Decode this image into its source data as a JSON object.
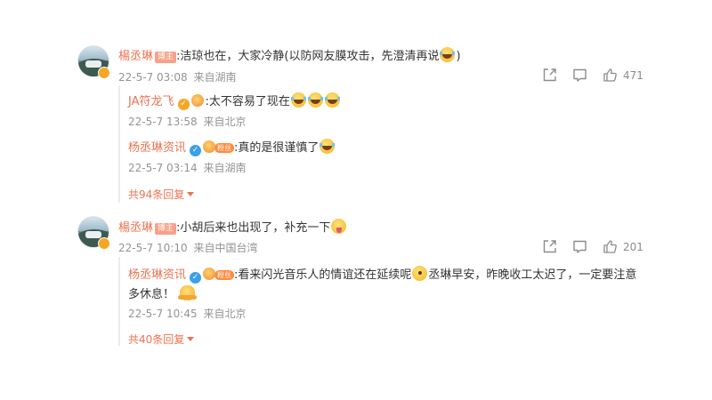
{
  "comments": [
    {
      "username": "楊丞琳",
      "host_tag": "博主",
      "text": ":洁琼也在，大家冷静(以防网友膜攻击，先澄清再说",
      "text_tail": ")",
      "date": "22-5-7 03:08",
      "location": "来自湖南",
      "like_count": "471",
      "replies": [
        {
          "username": "JA符龙飞",
          "text": ":太不容易了现在",
          "date": "22-5-7 13:58",
          "location": "来自北京"
        },
        {
          "username": "杨丞琳资讯",
          "text": ":真的是很谨慎了",
          "date": "22-5-7 03:14",
          "location": "来自湖南"
        }
      ],
      "more_replies": "共94条回复"
    },
    {
      "username": "楊丞琳",
      "host_tag": "博主",
      "text": ":小胡后来也出现了，补充一下",
      "date": "22-5-7 10:10",
      "location": "来自中国台湾",
      "like_count": "201",
      "replies": [
        {
          "username": "杨丞琳资讯",
          "text_line1": ":看来闪光音乐人的情谊还在延续呢",
          "text_line1b": "丞琳早安，昨晚收工太迟了，一定要注意",
          "text_line2": "多休息！",
          "date": "22-5-7 10:45",
          "location": "来自北京"
        }
      ],
      "more_replies": "共40条回复"
    }
  ],
  "icons": {
    "share": "share-icon",
    "comment": "comment-icon",
    "like": "thumbs-up-icon"
  }
}
